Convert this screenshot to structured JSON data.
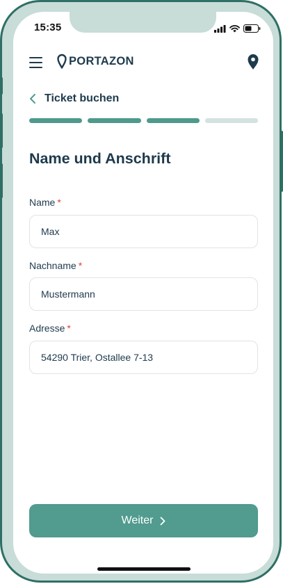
{
  "status_bar": {
    "time": "15:35",
    "icons": [
      "cellular-signal-icon",
      "wifi-icon",
      "battery-icon"
    ]
  },
  "header": {
    "menu_icon": "hamburger-menu-icon",
    "logo_icon": "map-pin-icon",
    "logo_text": "PORTAZON",
    "location_icon": "map-pin-icon"
  },
  "nav": {
    "back_icon": "chevron-left-icon",
    "title": "Ticket buchen"
  },
  "progress": {
    "total_steps": 4,
    "completed_steps": 3
  },
  "form": {
    "title": "Name und Anschrift",
    "fields": [
      {
        "label": "Name",
        "required_mark": "*",
        "value": "Max"
      },
      {
        "label": "Nachname",
        "required_mark": "*",
        "value": "Mustermann"
      },
      {
        "label": "Adresse",
        "required_mark": "*",
        "value": "54290 Trier, Ostallee 7-13"
      }
    ]
  },
  "actions": {
    "next_label": "Weiter",
    "next_icon": "chevron-right-icon"
  },
  "colors": {
    "frame": "#2f6f64",
    "frame_fill": "#c8dcd8",
    "primary": "#519b8f",
    "text_dark": "#1e3a4c",
    "required": "#d9453b",
    "progress_inactive": "#d3e3e0"
  }
}
